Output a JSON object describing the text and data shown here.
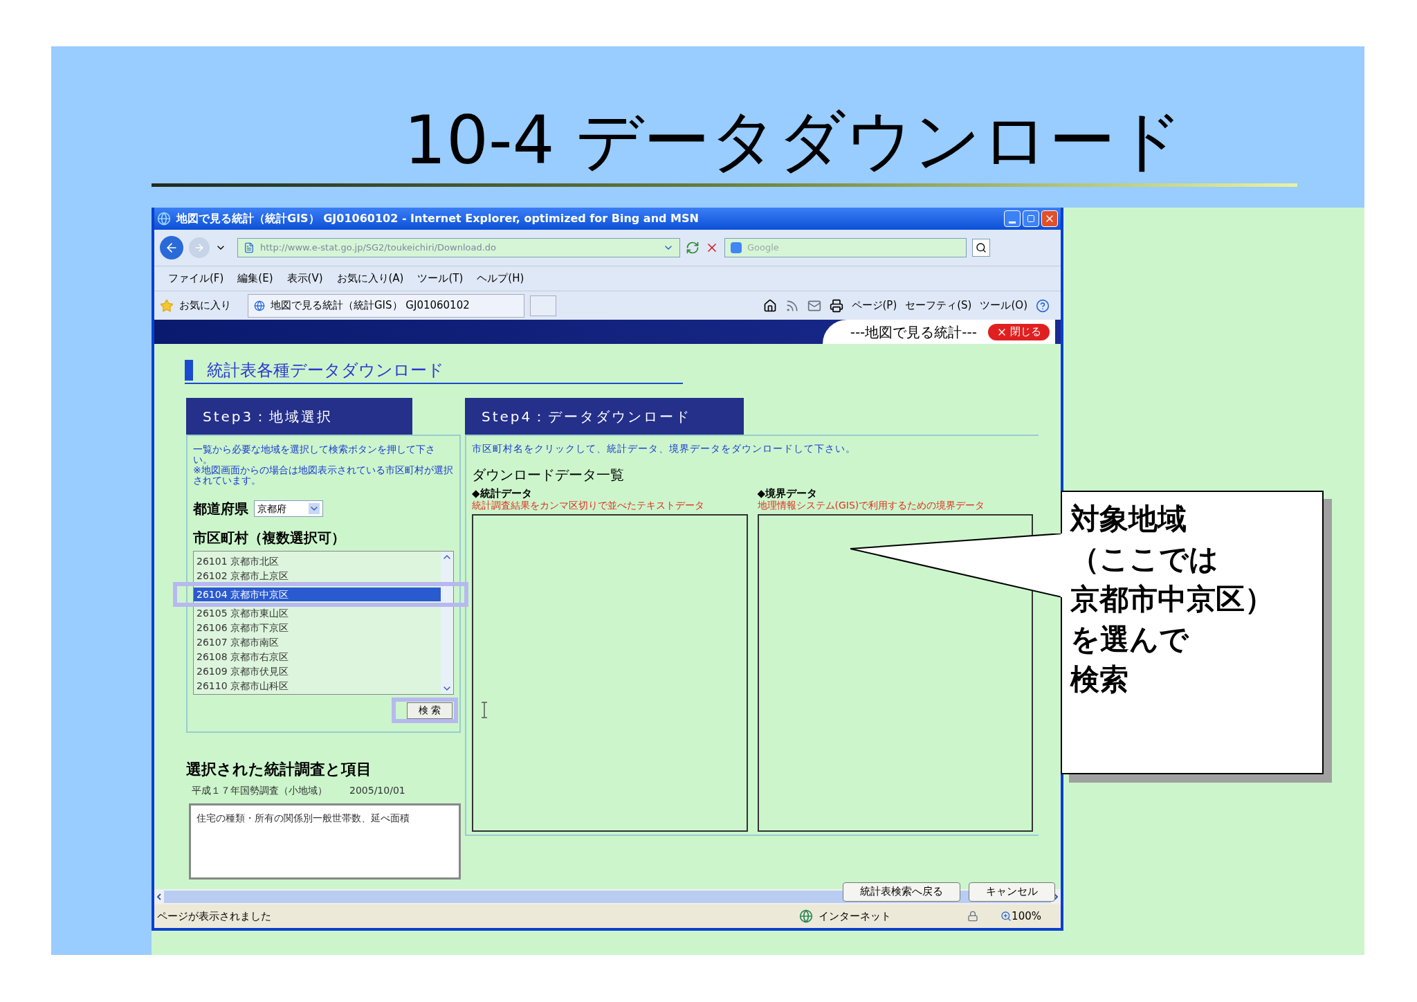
{
  "slide": {
    "title": "10-4 データダウンロード",
    "callout": [
      "対象地域",
      "（ここでは",
      "京都市中京区）",
      "を選んで",
      "検索"
    ]
  },
  "browser": {
    "window_title": "地図で見る統計（統計GIS） GJ01060102 - Internet Explorer, optimized for Bing and MSN",
    "address": "http://www.e-stat.go.jp/SG2/toukeichiri/Download.do",
    "search_placeholder": "Google",
    "menu": [
      "ファイル(F)",
      "編集(E)",
      "表示(V)",
      "お気に入り(A)",
      "ツール(T)",
      "ヘルプ(H)"
    ],
    "favorites": "お気に入り",
    "tab_title": "地図で見る統計（統計GIS） GJ01060102",
    "commands": [
      "ページ(P)",
      "セーフティ(S)",
      "ツール(O)"
    ]
  },
  "page": {
    "banner": "---地図で見る統計---",
    "close_button": "閉じる",
    "heading": "統計表各種データダウンロード",
    "step3": {
      "title": "Step3：地域選択",
      "instructions": [
        "一覧から必要な地域を選択して検索ボタンを押して下さい。",
        "※地図画面からの場合は地図表示されている市区町村が選択されています。"
      ],
      "prefecture_label": "都道府県",
      "prefecture_value": "京都府",
      "municipality_label": "市区町村（複数選択可）",
      "municipalities": [
        {
          "label": "26101 京都市北区",
          "selected": false
        },
        {
          "label": "26102 京都市上京区",
          "selected": false
        },
        {
          "label": "26104 京都市中京区",
          "selected": true
        },
        {
          "label": "26105 京都市東山区",
          "selected": false
        },
        {
          "label": "26106 京都市下京区",
          "selected": false
        },
        {
          "label": "26107 京都市南区",
          "selected": false
        },
        {
          "label": "26108 京都市右京区",
          "selected": false
        },
        {
          "label": "26109 京都市伏見区",
          "selected": false
        },
        {
          "label": "26110 京都市山科区",
          "selected": false
        }
      ],
      "search_button": "検 索",
      "selected_heading": "選択された統計調査と項目",
      "survey": "平成１７年国勢調査（小地域）",
      "date": "2005/10/01",
      "items_text": "住宅の種類・所有の関係別一般世帯数、延べ面積"
    },
    "step4": {
      "title": "Step4：データダウンロード",
      "instruction": "市区町村名をクリックして、統計データ、境界データをダウンロードして下さい。",
      "list_heading": "ダウンロードデータ一覧",
      "lists": [
        {
          "title": "◆統計データ",
          "description": "統計調査結果をカンマ区切りで並べたテキストデータ"
        },
        {
          "title": "◆境界データ",
          "description": "地理情報システム(GIS)で利用するための境界データ"
        }
      ]
    },
    "buttons": [
      "統計表検索へ戻る",
      "キャンセル"
    ]
  },
  "status": {
    "text": "ページが表示されました",
    "zone": "インターネット",
    "zoom": "100%"
  }
}
